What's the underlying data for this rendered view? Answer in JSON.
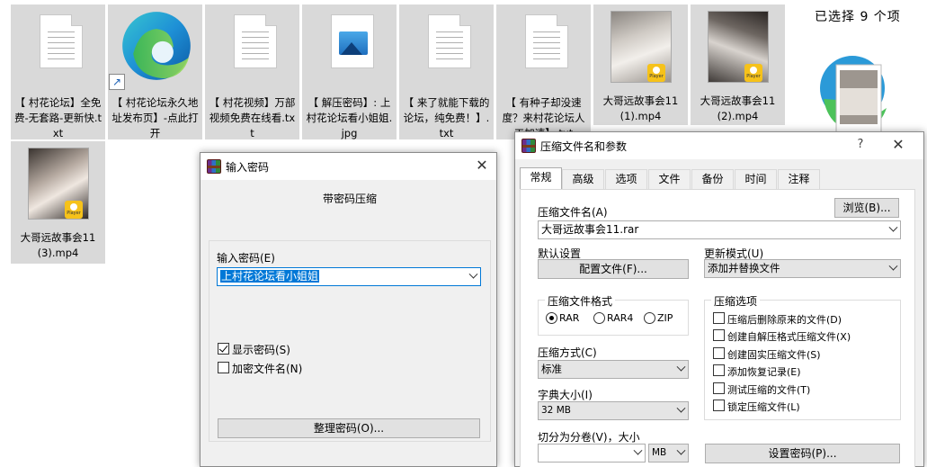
{
  "files": [
    {
      "label": "【 村花论坛】全免费-无套路-更新快.txt",
      "kind": "text"
    },
    {
      "label": "【 村花论坛永久地址发布页】-点此打开",
      "kind": "edge"
    },
    {
      "label": "【 村花视频】万部视频免费在线看.txt",
      "kind": "text"
    },
    {
      "label": "【 解压密码】: 上村花论坛看小姐姐.jpg",
      "kind": "image"
    },
    {
      "label": "【 来了就能下载的论坛，纯免费！】.txt",
      "kind": "text"
    },
    {
      "label": "【 有种子却没速度？来村花论坛人工加速】.txt",
      "kind": "text"
    },
    {
      "label": "大哥远故事会11(1).mp4",
      "kind": "video"
    },
    {
      "label": "大哥远故事会11(2).mp4",
      "kind": "video"
    },
    {
      "label": "大哥远故事会11(3).mp4",
      "kind": "video"
    }
  ],
  "player_badge": "Player",
  "details_pane": {
    "selection_text": "已选择 9 个项"
  },
  "password_dialog": {
    "title": "输入密码",
    "subtitle": "带密码压缩",
    "password_label": "输入密码(E)",
    "password_value": "上村花论坛看小姐姐",
    "show_password_label": "显示密码(S)",
    "show_password_checked": true,
    "encrypt_names_label": "加密文件名(N)",
    "encrypt_names_checked": false,
    "organize_button": "整理密码(O)..."
  },
  "archive_dialog": {
    "title": "压缩文件名和参数",
    "help": "?",
    "tabs": [
      "常规",
      "高级",
      "选项",
      "文件",
      "备份",
      "时间",
      "注释"
    ],
    "active_tab": "常规",
    "archive_name_label": "压缩文件名(A)",
    "archive_name_value": "大哥远故事会11.rar",
    "browse_button": "浏览(B)...",
    "default_settings_label": "默认设置",
    "profiles_button": "配置文件(F)...",
    "update_mode_label": "更新模式(U)",
    "update_mode_value": "添加并替换文件",
    "format_group_label": "压缩文件格式",
    "formats": [
      {
        "label": "RAR",
        "selected": true
      },
      {
        "label": "RAR4",
        "selected": false
      },
      {
        "label": "ZIP",
        "selected": false
      }
    ],
    "method_label": "压缩方式(C)",
    "method_value": "标准",
    "dict_label": "字典大小(I)",
    "dict_value": "32 MB",
    "split_label": "切分为分卷(V)，大小",
    "split_value": "",
    "split_unit": "MB",
    "options_group_label": "压缩选项",
    "options": [
      {
        "label": "压缩后删除原来的文件(D)",
        "checked": false
      },
      {
        "label": "创建自解压格式压缩文件(X)",
        "checked": false
      },
      {
        "label": "创建固实压缩文件(S)",
        "checked": false
      },
      {
        "label": "添加恢复记录(E)",
        "checked": false
      },
      {
        "label": "测试压缩的文件(T)",
        "checked": false
      },
      {
        "label": "锁定压缩文件(L)",
        "checked": false
      }
    ],
    "set_password_button": "设置密码(P)..."
  }
}
